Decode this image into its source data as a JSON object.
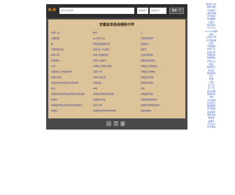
{
  "header": {
    "logo": "0.0",
    "search_placeholder": "搜索人物名称",
    "field_a": "热歌排行",
    "field_b": "姓名配对",
    "search_button": "搜索一下"
  },
  "page_title": "安徽省阜南县朝新中学",
  "rows": [
    [
      "阜南一览",
      "教育",
      "人"
    ],
    [
      "乡镇街道",
      "gps定位大全",
      "汇报学校名称"
    ],
    [
      "街",
      "学校风格品牌社区",
      "名校名片"
    ],
    [
      "阜南特色社区",
      "阜南 是 十大名校",
      "名称不"
    ],
    [
      "阜南小学",
      "阜南 大型教育区",
      "汇报阜南学校"
    ],
    [
      "阜南学校",
      "阜南 大学排行",
      "合肥市普通学生"
    ],
    [
      "小学",
      "阜南县小学排行学校",
      "阜南县小学的信息"
    ],
    [
      "阜南网上小学生课外学",
      "阜南 大学",
      "阜南县小学学校"
    ],
    [
      "阜南小学生",
      "阜南小学生活",
      "阜南县高年级"
    ],
    [
      "阜南县中学生初学生阜南中学",
      "阜南学生",
      "阜南县中学的"
    ],
    [
      "初中",
      "中学",
      "高中"
    ],
    [
      "阜南县中学生学校名称初中高中名单",
      "阜南初中学校排行名称",
      "阜南县中学的"
    ],
    [
      "阜南中",
      "阜南县中学生",
      "阜南学校名称学生"
    ],
    [
      "阜南县中学生阜南中学生学校排行",
      "阜南 大学",
      "合肥市普通学生中学"
    ],
    [
      "阜南名",
      "阜南的阜南中学阜南中学",
      "阜南学校的"
    ]
  ],
  "back_top": "回顶部",
  "sidebar": [
    "繁体字大全",
    "繁体字典",
    "大写数字",
    "火星文转换",
    "汉字拼音",
    "在线翻译",
    "火星文",
    "姓名测试",
    "Unicode",
    "Unicode编码",
    "在线",
    "人民币大写",
    "汉字转拼音",
    "拼音",
    "五笔编码",
    "在线工具",
    "在线计算",
    "字典查询",
    "简繁转换",
    "符号大全",
    "姓名",
    "姓名配对",
    "英文名",
    "笔画查询",
    "汉字",
    "成语",
    "词语",
    "近义词",
    "反义词",
    "在线词典",
    "繁体转换",
    "字体",
    "汉字笔顺",
    "汉字拆分",
    "偏旁部首",
    "汉字结构",
    "说文解字",
    "康熙字典",
    "百家姓",
    "生僻字",
    "汉字五行",
    "汉字笔画"
  ],
  "colors": {
    "frame": "#4a4a4a",
    "panel": "#dcc39a",
    "link": "#3a3a8a",
    "accent": "#f0a030"
  }
}
